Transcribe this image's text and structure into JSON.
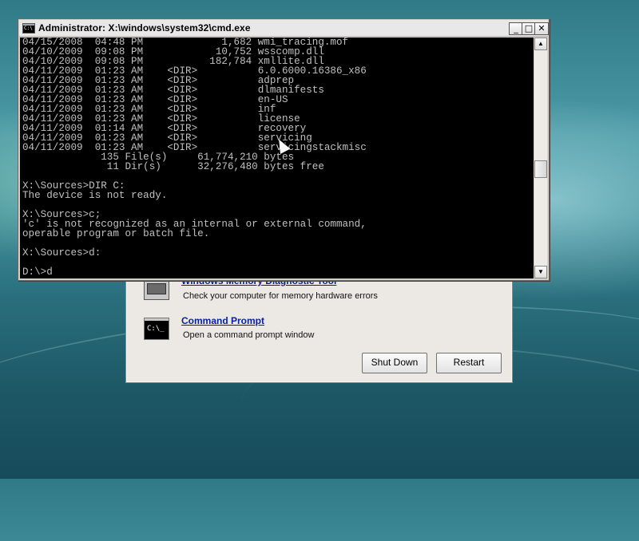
{
  "console": {
    "title": "Administrator: X:\\windows\\system32\\cmd.exe",
    "icon_label": "C:\\",
    "buttons": {
      "minimize": "_",
      "maximize": "□",
      "close": "✕"
    },
    "lines": [
      "04/15/2008  04:48 PM             1,682 wmi_tracing.mof",
      "04/10/2009  09:08 PM            10,752 wsscomp.dll",
      "04/10/2009  09:08 PM           182,784 xmllite.dll",
      "04/11/2009  01:23 AM    <DIR>          6.0.6000.16386_x86",
      "04/11/2009  01:23 AM    <DIR>          adprep",
      "04/11/2009  01:23 AM    <DIR>          dlmanifests",
      "04/11/2009  01:23 AM    <DIR>          en-US",
      "04/11/2009  01:23 AM    <DIR>          inf",
      "04/11/2009  01:23 AM    <DIR>          license",
      "04/11/2009  01:14 AM    <DIR>          recovery",
      "04/11/2009  01:23 AM    <DIR>          servicing",
      "04/11/2009  01:23 AM    <DIR>          servicingstackmisc",
      "             135 File(s)     61,774,210 bytes",
      "              11 Dir(s)      32,276,480 bytes free",
      "",
      "X:\\Sources>DIR C:",
      "The device is not ready.",
      "",
      "X:\\Sources>c;",
      "'c' is not recognized as an internal or external command,",
      "operable program or batch file.",
      "",
      "X:\\Sources>d:",
      "",
      "D:\\>d"
    ],
    "scroll_up": "▲",
    "scroll_down": "▼"
  },
  "recovery": {
    "items": [
      {
        "title": "Windows Memory Diagnostic Tool",
        "desc": "Check your computer for memory hardware errors",
        "icon": "memory-chip-icon"
      },
      {
        "title": "Command Prompt",
        "desc": "Open a command prompt window",
        "icon": "command-prompt-icon"
      }
    ],
    "cmd_icon_label": "C:\\_",
    "shutdown_label": "Shut Down",
    "restart_label": "Restart"
  }
}
